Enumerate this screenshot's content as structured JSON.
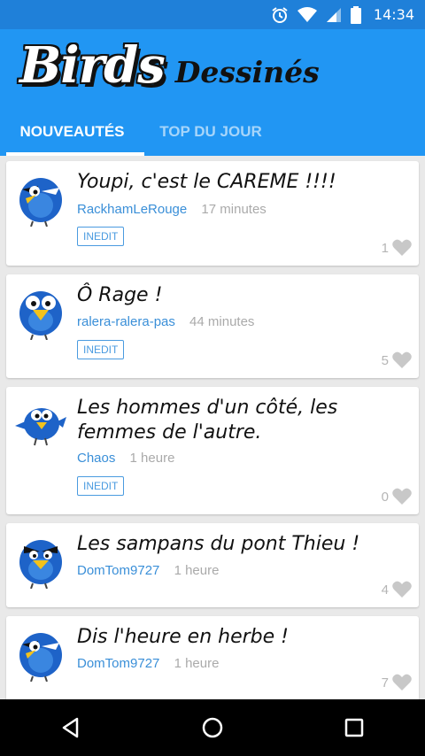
{
  "status_bar": {
    "time": "14:34",
    "icons": [
      "alarm-icon",
      "wifi-icon",
      "signal-icon",
      "battery-icon"
    ]
  },
  "app": {
    "title_main": "Birds",
    "title_sub": "Dessinés"
  },
  "tabs": [
    {
      "label": "NOUVEAUTÉS",
      "active": true
    },
    {
      "label": "TOP DU JOUR",
      "active": false
    }
  ],
  "posts": [
    {
      "title": "Youpi, c'est le CAREME !!!!",
      "author": "RackhamLeRouge",
      "time": "17 minutes",
      "badge": "INEDIT",
      "likes": "1"
    },
    {
      "title": "Ô Rage !",
      "author": "ralera-ralera-pas",
      "time": "44 minutes",
      "badge": "INEDIT",
      "likes": "5"
    },
    {
      "title": "Les hommes d'un côté, les femmes de l'autre.",
      "author": "Chaos",
      "time": "1 heure",
      "badge": "INEDIT",
      "likes": "0"
    },
    {
      "title": "Les sampans du pont Thieu !",
      "author": "DomTom9727",
      "time": "1 heure",
      "badge": "",
      "likes": "4"
    },
    {
      "title": "Dis l'heure en herbe !",
      "author": "DomTom9727",
      "time": "1 heure",
      "badge": "",
      "likes": "7"
    }
  ],
  "colors": {
    "primary": "#2196f3",
    "status": "#1f80d9",
    "link": "#3a8fd8"
  }
}
